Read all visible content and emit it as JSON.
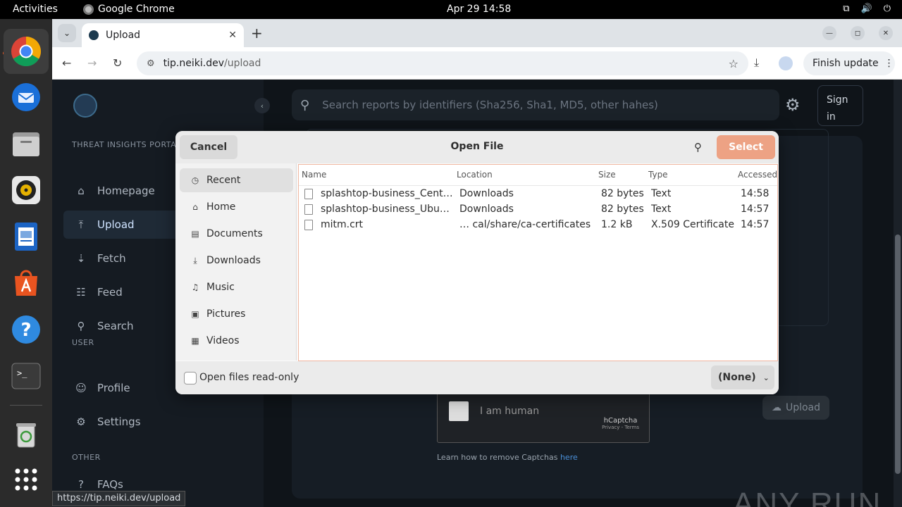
{
  "topbar": {
    "activities": "Activities",
    "app_name": "Google Chrome",
    "clock": "Apr 29  14:58"
  },
  "dock": {
    "items": [
      "chrome-icon",
      "thunderbird-icon",
      "files-icon",
      "rhythmbox-icon",
      "writer-icon",
      "app-center-icon",
      "help-icon",
      "terminal-icon",
      "trash-icon",
      "app-grid-icon"
    ]
  },
  "browser": {
    "tab_title": "Upload",
    "url_host": "tip.neiki.dev",
    "url_path": "/upload",
    "finish_update": "Finish update",
    "status_url": "https://tip.neiki.dev/upload"
  },
  "site": {
    "search_placeholder": "Search reports by identifiers (Sha256, Sha1, MD5, other hahes)",
    "signin_line1": "Sign",
    "signin_line2": "in",
    "sections": {
      "portal": "THREAT INSIGHTS PORTAL",
      "user": "USER",
      "other": "OTHER"
    },
    "nav": [
      {
        "label": "Homepage",
        "icon": "home-icon"
      },
      {
        "label": "Upload",
        "icon": "upload-icon"
      },
      {
        "label": "Fetch",
        "icon": "fetch-icon"
      },
      {
        "label": "Feed",
        "icon": "feed-icon"
      },
      {
        "label": "Search",
        "icon": "search-icon"
      },
      {
        "label": "Profile",
        "icon": "profile-icon"
      },
      {
        "label": "Settings",
        "icon": "gear-icon"
      },
      {
        "label": "FAQs",
        "icon": "faq-icon"
      }
    ],
    "captcha_label": "I am human",
    "captcha_brand": "hCaptcha",
    "captcha_links": "Privacy - Terms",
    "captcha_hint": "Learn how to remove Captchas",
    "captcha_hint_link": "here",
    "upload_button": "Upload"
  },
  "dialog": {
    "title": "Open File",
    "cancel": "Cancel",
    "select": "Select",
    "places": [
      "Recent",
      "Home",
      "Documents",
      "Downloads",
      "Music",
      "Pictures",
      "Videos"
    ],
    "columns": [
      "Name",
      "Location",
      "Size",
      "Type",
      "Accessed"
    ],
    "files": [
      {
        "name": "splashtop-business_Cent…",
        "location": "Downloads",
        "size": "82 bytes",
        "type": "Text",
        "accessed": "14:58"
      },
      {
        "name": "splashtop-business_Ubu…",
        "location": "Downloads",
        "size": "82 bytes",
        "type": "Text",
        "accessed": "14:57"
      },
      {
        "name": "mitm.crt",
        "location": "… cal/share/ca-certificates",
        "size": "1.2 kB",
        "type": "X.509 Certificate",
        "accessed": "14:57"
      }
    ],
    "readonly_label": "Open files read-only",
    "filter": "(None)"
  },
  "watermark": "ANY RUN"
}
